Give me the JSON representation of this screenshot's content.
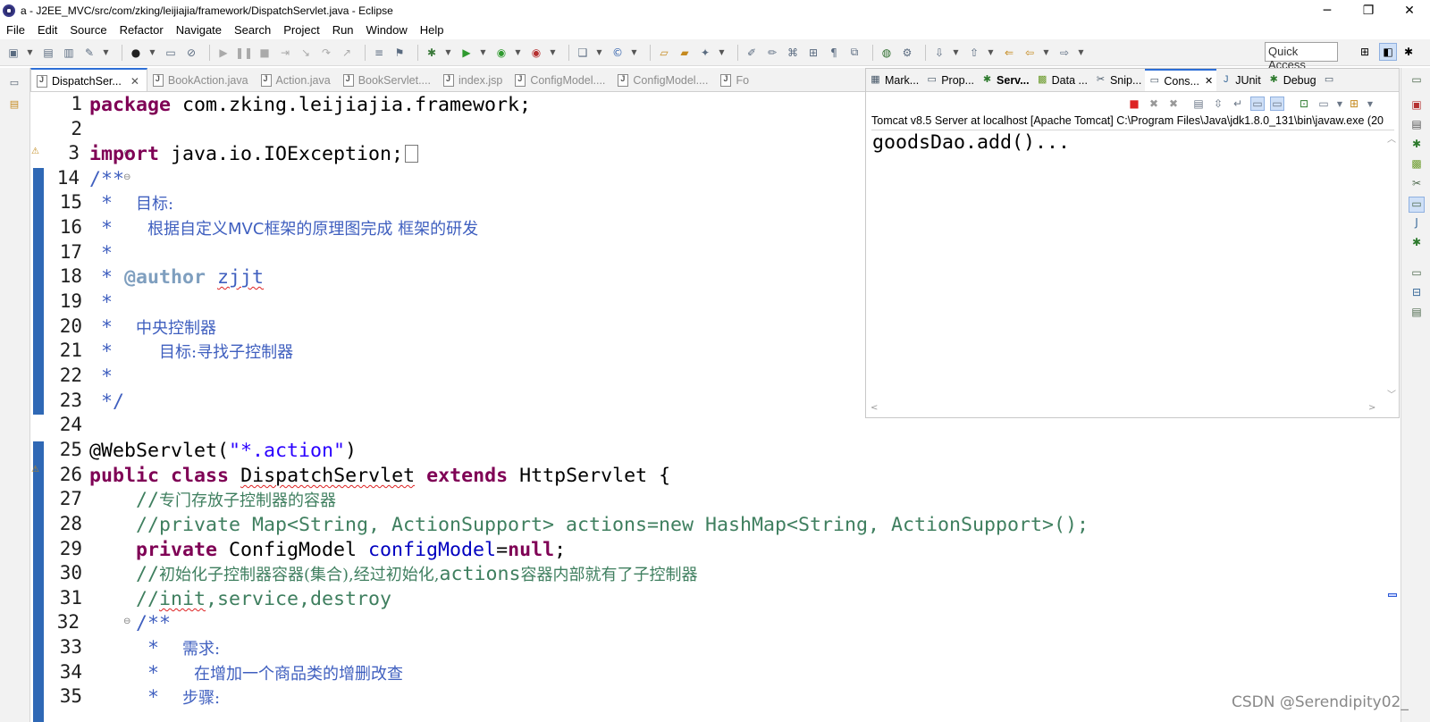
{
  "window": {
    "title": "a - J2EE_MVC/src/com/zking/leijiajia/framework/DispatchServlet.java - Eclipse",
    "minimize": "─",
    "maximize": "❐",
    "close": "✕"
  },
  "menu": [
    "File",
    "Edit",
    "Source",
    "Refactor",
    "Navigate",
    "Search",
    "Project",
    "Run",
    "Window",
    "Help"
  ],
  "quick_access": "Quick Access",
  "editor": {
    "tabs": [
      {
        "label": "DispatchSer...",
        "active": true
      },
      {
        "label": "BookAction.java",
        "active": false
      },
      {
        "label": "Action.java",
        "active": false
      },
      {
        "label": "BookServlet....",
        "active": false
      },
      {
        "label": "index.jsp",
        "active": false
      },
      {
        "label": "ConfigModel....",
        "active": false
      },
      {
        "label": "ConfigModel....",
        "active": false
      },
      {
        "label": "Fo",
        "active": false
      }
    ],
    "close_glyph": "✕",
    "line_numbers": [
      "1",
      "2",
      "3",
      "14",
      "15",
      "16",
      "17",
      "18",
      "19",
      "20",
      "21",
      "22",
      "23",
      "24",
      "25",
      "26",
      "27",
      "28",
      "29",
      "30",
      "31",
      "32",
      "33",
      "34",
      "35"
    ],
    "code": {
      "l1_kw": "package",
      "l1_rest": " com.zking.leijiajia.framework;",
      "l3_kw": "import",
      "l3_rest": " java.io.IOException;",
      "l14": "/**",
      "l15_star": " *  ",
      "l15_text": "目标:",
      "l16_star": " *   ",
      "l16_text_a": "根据自定义",
      "l16_text_b": "MVC",
      "l16_text_c": "框架的原理图完成 框架的研发",
      "l17": " *",
      "l18_star": " * ",
      "l18_tag": "@author",
      "l18_name": "zjjt",
      "l19": " *",
      "l20_star": " *  ",
      "l20_text": "中央控制器",
      "l21_star": " *    ",
      "l21_text": "目标:寻找子控制器",
      "l22": " *",
      "l23": " */",
      "l25_ann": "@WebServlet(",
      "l25_str": "\"*.action\"",
      "l25_end": ")",
      "l26_kw1": "public",
      "l26_kw2": "class",
      "l26_name": "DispatchServlet",
      "l26_kw3": "extends",
      "l26_rest": " HttpServlet {",
      "l27_slash": "    //",
      "l27_text": "专门存放子控制器的容器",
      "l28": "    //private Map<String, ActionSupport> actions=new HashMap<String, ActionSupport>();",
      "l29_kw": "private",
      "l29_type": " ConfigModel ",
      "l29_field": "configModel",
      "l29_eq": "=",
      "l29_null": "null",
      "l29_end": ";",
      "l30_slash": "    //",
      "l30_text_a": "初始化子控制器容器(集合),经过初始化,",
      "l30_text_b": "actions",
      "l30_text_c": "容器内部就有了子控制器",
      "l31_slash": "    //",
      "l31_init": "init",
      "l31_rest": ",service,destroy",
      "l32": "    /**",
      "l33_star": "     *  ",
      "l33_text": "需求:",
      "l34_star": "     *   ",
      "l34_text": "在增加一个商品类的增删改查",
      "l35_star": "     *  ",
      "l35_text": "步骤:"
    }
  },
  "console": {
    "tabs": [
      {
        "icon": "markers-icon",
        "label": "Mark..."
      },
      {
        "icon": "properties-icon",
        "label": "Prop..."
      },
      {
        "icon": "servers-icon",
        "label": "Serv..."
      },
      {
        "icon": "datasource-icon",
        "label": "Data ..."
      },
      {
        "icon": "snippets-icon",
        "label": "Snip..."
      },
      {
        "icon": "console-icon",
        "label": "Cons..."
      },
      {
        "icon": "junit-icon",
        "label": "JUnit"
      },
      {
        "icon": "debug-icon",
        "label": "Debug"
      }
    ],
    "header": "Tomcat v8.5 Server at localhost [Apache Tomcat] C:\\Program Files\\Java\\jdk1.8.0_131\\bin\\javaw.exe (20",
    "output": "goodsDao.add()..."
  },
  "watermark": "CSDN @Serendipity02_",
  "colors": {
    "keyword": "#7f0055",
    "javadoc": "#3f5fbf",
    "line_comment": "#3f7f5f",
    "string": "#2a00ff",
    "field": "#0000c0",
    "active_tab_accent": "#2d6fd6"
  }
}
